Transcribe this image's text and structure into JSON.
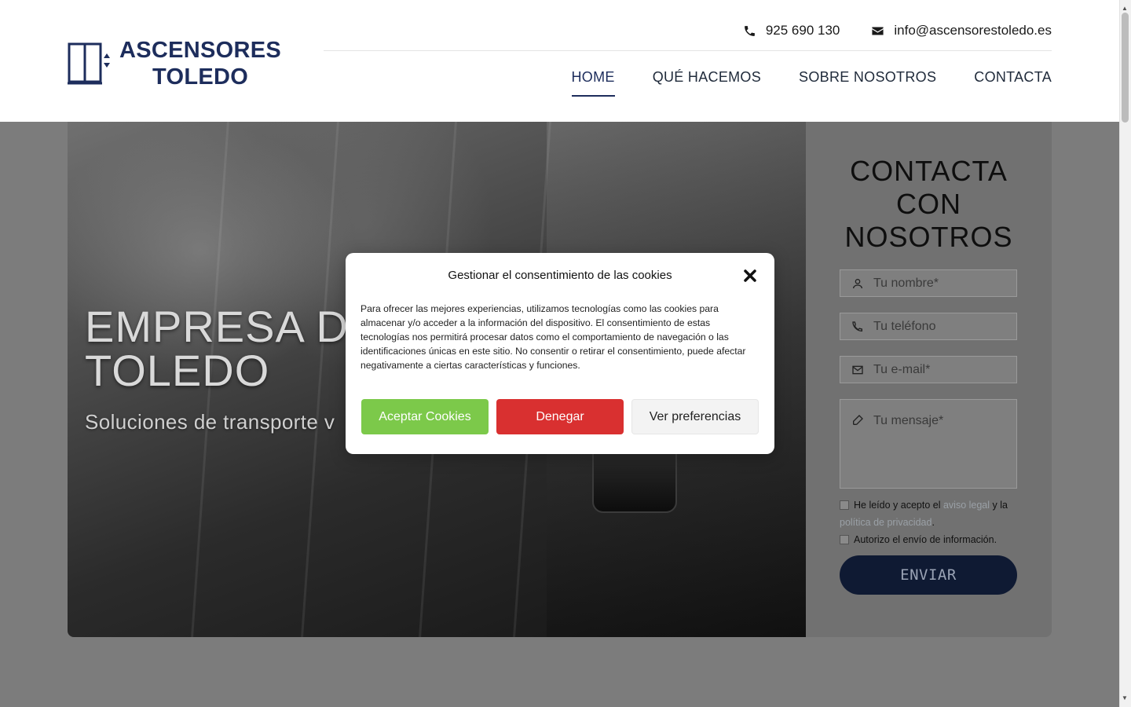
{
  "logo": {
    "line1": "ASCENSORES",
    "line2": "TOLEDO",
    "icon": "elevator-door-icon"
  },
  "topbar": {
    "phone": "925 690 130",
    "email": "info@ascensorestoledo.es"
  },
  "nav": {
    "items": [
      {
        "label": "HOME",
        "active": true
      },
      {
        "label": "QUÉ HACEMOS",
        "active": false
      },
      {
        "label": "SOBRE NOSOTROS",
        "active": false
      },
      {
        "label": "CONTACTA",
        "active": false
      }
    ]
  },
  "hero": {
    "title_line1": "EMPRESA DE",
    "title_line2": "TOLEDO",
    "subtitle": "Soluciones de transporte v"
  },
  "contact": {
    "title_line1": "CONTACTA",
    "title_line2": "CON",
    "title_line3": "NOSOTROS",
    "name_placeholder": "Tu nombre*",
    "phone_placeholder": "Tu teléfono",
    "email_placeholder": "Tu e-mail*",
    "message_placeholder": "Tu mensaje*",
    "legal_prefix": "He leído y acepto el ",
    "legal_link": "aviso legal",
    "legal_mid": " y la ",
    "privacy_link": "política de privacidad",
    "legal_suffix": ".",
    "consent_label": "Autorizo el envío de información.",
    "send_label": "ENVIAR"
  },
  "cookie_modal": {
    "title": "Gestionar el consentimiento de las cookies",
    "body": "Para ofrecer las mejores experiencias, utilizamos tecnologías como las cookies para almacenar y/o acceder a la información del dispositivo. El consentimiento de estas tecnologías nos permitirá procesar datos como el comportamiento de navegación o las identificaciones únicas en este sitio. No consentir o retirar el consentimiento, puede afectar negativamente a ciertas características y funciones.",
    "accept_label": "Aceptar Cookies",
    "deny_label": "Denegar",
    "prefs_label": "Ver preferencias"
  },
  "colors": {
    "brand": "#1d2d5c",
    "accept": "#7cc94a",
    "deny": "#d93030"
  }
}
